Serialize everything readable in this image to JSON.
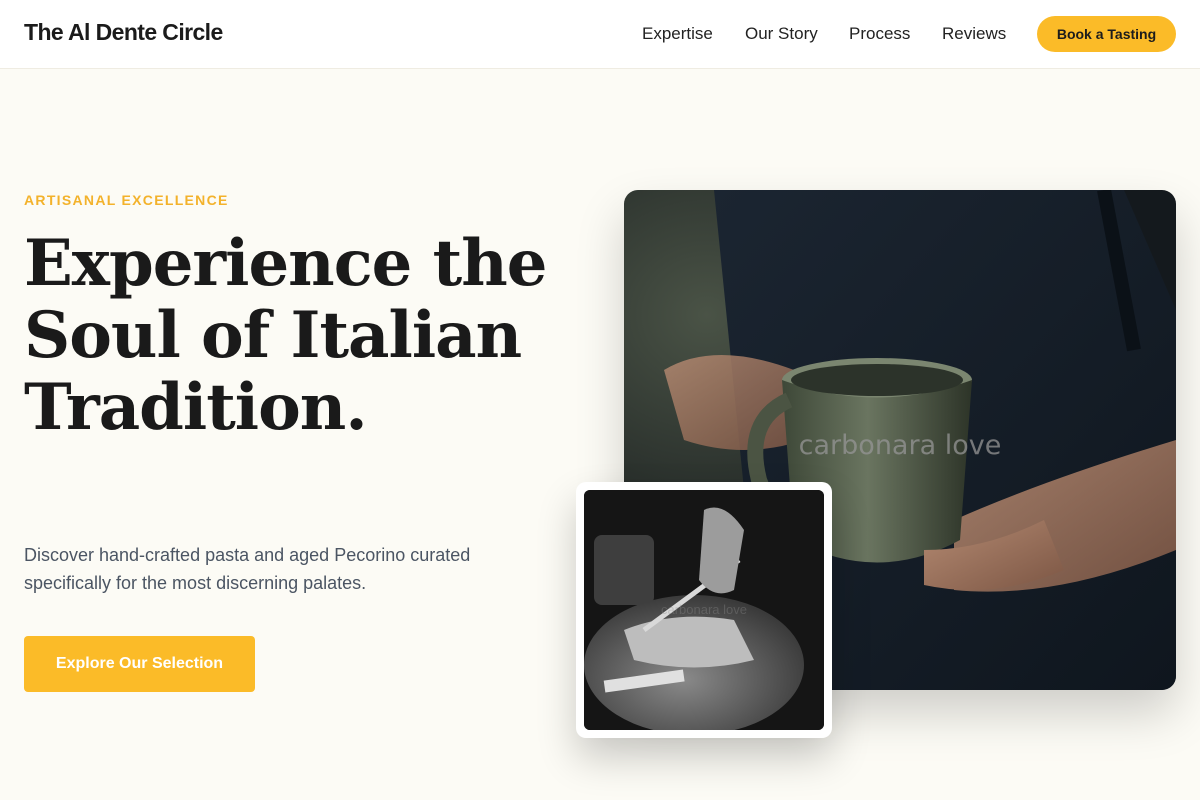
{
  "header": {
    "brand": "The Al Dente Circle",
    "nav": [
      "Expertise",
      "Our Story",
      "Process",
      "Reviews"
    ],
    "cta_label": "Book a Tasting"
  },
  "hero": {
    "eyebrow": "ARTISANAL EXCELLENCE",
    "headline": "Experience the Soul of Italian Tradition.",
    "subcopy": "Discover hand-crafted pasta and aged Pecorino curated specifically for the most discerning palates.",
    "cta_label": "Explore Our Selection"
  },
  "images": {
    "main_caption": "carbonara love",
    "secondary_caption": "carbonara love"
  },
  "colors": {
    "accent": "#fbbb28",
    "eyebrow": "#f3b22b",
    "page_background": "#fcfbf5",
    "body_text": "#4b5563"
  }
}
